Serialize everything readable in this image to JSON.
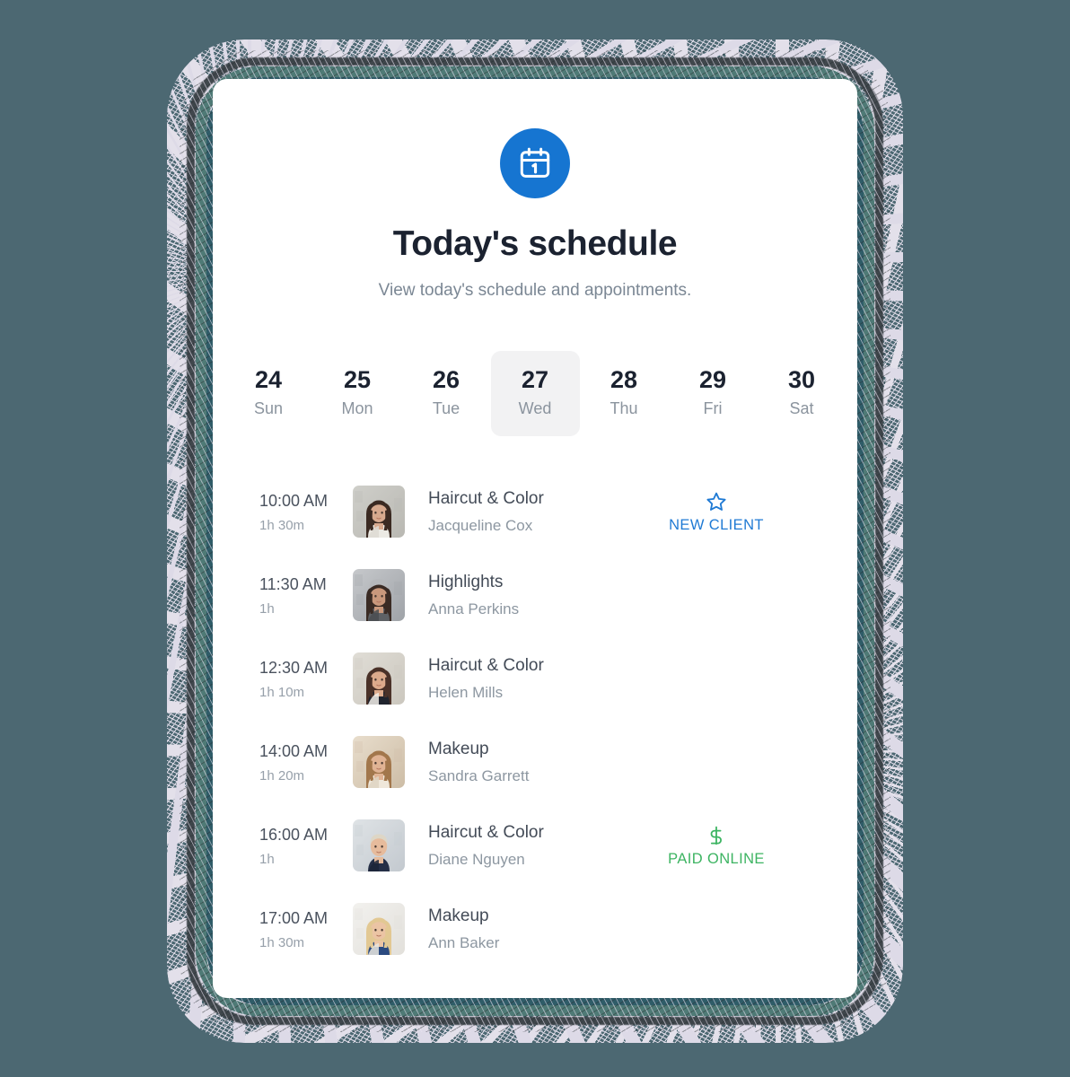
{
  "theme": {
    "background": "#4c6872",
    "card_background": "#ffffff",
    "accent_blue": "#1675d1",
    "badge_blue": "#1f7ad4",
    "badge_green": "#3db462",
    "selected_day_background": "#f2f2f3"
  },
  "header": {
    "icon": "calendar-icon",
    "icon_day_number": "1",
    "title": "Today's schedule",
    "subtitle": "View today's schedule and appointments."
  },
  "week": {
    "days": [
      {
        "num": "24",
        "name": "Sun",
        "selected": false
      },
      {
        "num": "25",
        "name": "Mon",
        "selected": false
      },
      {
        "num": "26",
        "name": "Tue",
        "selected": false
      },
      {
        "num": "27",
        "name": "Wed",
        "selected": true
      },
      {
        "num": "28",
        "name": "Thu",
        "selected": false
      },
      {
        "num": "29",
        "name": "Fri",
        "selected": false
      },
      {
        "num": "30",
        "name": "Sat",
        "selected": false
      }
    ]
  },
  "appointments": [
    {
      "time": "10:00 AM",
      "duration": "1h 30m",
      "service": "Haircut & Color",
      "client": "Jacqueline Cox",
      "avatar": "avatar-jacqueline-cox",
      "badge": {
        "text": "NEW CLIENT",
        "icon": "star-icon",
        "color": "#1f7ad4",
        "kind": "new"
      }
    },
    {
      "time": "11:30 AM",
      "duration": "1h",
      "service": "Highlights",
      "client": "Anna Perkins",
      "avatar": "avatar-anna-perkins",
      "badge": null
    },
    {
      "time": "12:30 AM",
      "duration": "1h 10m",
      "service": "Haircut & Color",
      "client": "Helen Mills",
      "avatar": "avatar-helen-mills",
      "badge": null
    },
    {
      "time": "14:00 AM",
      "duration": "1h 20m",
      "service": "Makeup",
      "client": "Sandra Garrett",
      "avatar": "avatar-sandra-garrett",
      "badge": null
    },
    {
      "time": "16:00 AM",
      "duration": "1h",
      "service": "Haircut & Color",
      "client": "Diane Nguyen",
      "avatar": "avatar-diane-nguyen",
      "badge": {
        "text": "PAID ONLINE",
        "icon": "dollar-icon",
        "color": "#3db462",
        "kind": "paid"
      }
    },
    {
      "time": "17:00 AM",
      "duration": "1h 30m",
      "service": "Makeup",
      "client": "Ann Baker",
      "avatar": "avatar-ann-baker",
      "badge": null
    }
  ]
}
